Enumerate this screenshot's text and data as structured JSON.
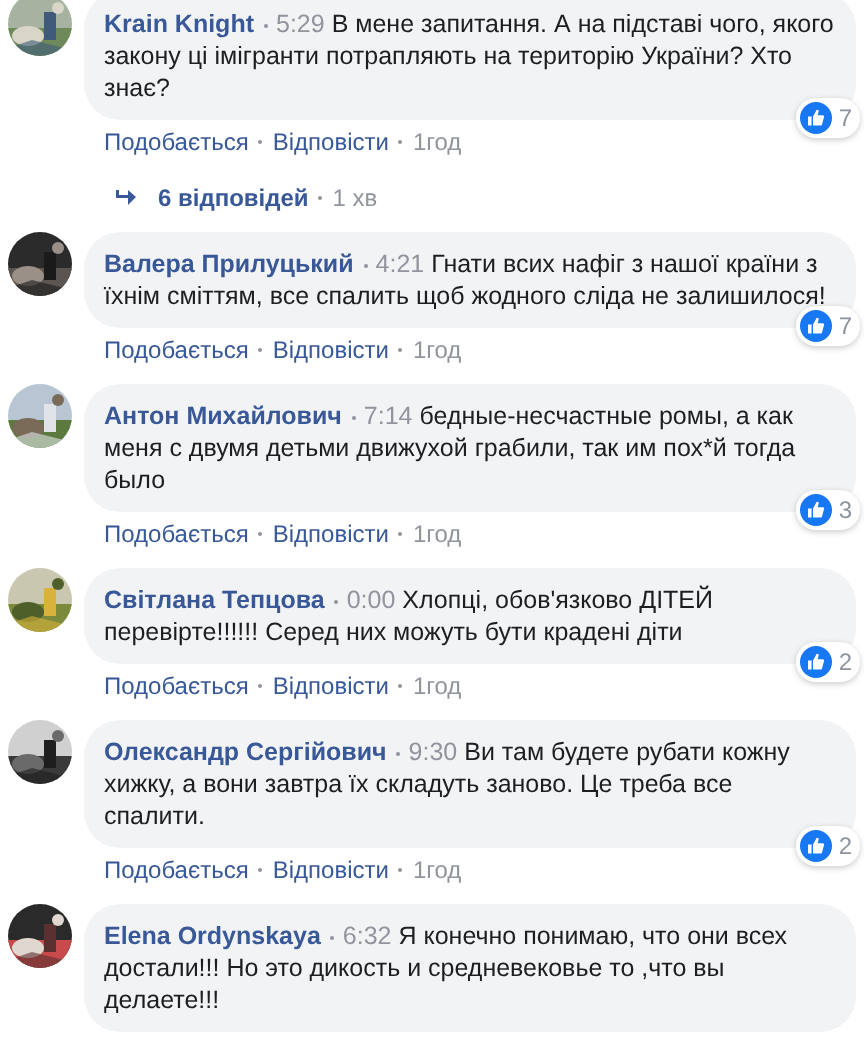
{
  "comments": [
    {
      "author": "Krain Knight",
      "time": "5:29",
      "text": "В мене запитання. А на підставі чого, якого закону ці імігранти потрапляють на територію України? Хто знає?",
      "likes": "7",
      "actions": [
        "Подобається",
        "Відповісти"
      ],
      "age": "1год",
      "replies": {
        "label": "6 відповідей",
        "age": "1 хв"
      }
    },
    {
      "author": "Валера Прилуцький",
      "time": "4:21",
      "text": "Гнати всих нафіг з нашої країни з їхнім сміттям, все спалить щоб жодного сліда не залишилося!",
      "likes": "7",
      "actions": [
        "Подобається",
        "Відповісти"
      ],
      "age": "1год"
    },
    {
      "author": "Антон Михайлович",
      "time": "7:14",
      "text": "бедные-несчастные ромы, а как меня с двумя детьми движухой грабили, так им пох*й тогда было",
      "likes": "3",
      "actions": [
        "Подобається",
        "Відповісти"
      ],
      "age": "1год"
    },
    {
      "author": "Світлана Тепцова",
      "time": "0:00",
      "text": "Хлопці, обов'язково ДІТЕЙ перевірте!!!!!! Серед них можуть бути крадені діти",
      "likes": "2",
      "actions": [
        "Подобається",
        "Відповісти"
      ],
      "age": "1год"
    },
    {
      "author": "Олександр Сергійович",
      "time": "9:30",
      "text": "Ви там будете рубати кожну хижку, а вони завтра їх складуть заново. Це треба все спалити.",
      "likes": "2",
      "actions": [
        "Подобається",
        "Відповісти"
      ],
      "age": "1год"
    },
    {
      "author": "Elena Ordynskaya",
      "time": "6:32",
      "text": "Я конечно понимаю, что они всех достали!!! Но это дикость и средневековье то ,что вы делаете!!!"
    }
  ]
}
